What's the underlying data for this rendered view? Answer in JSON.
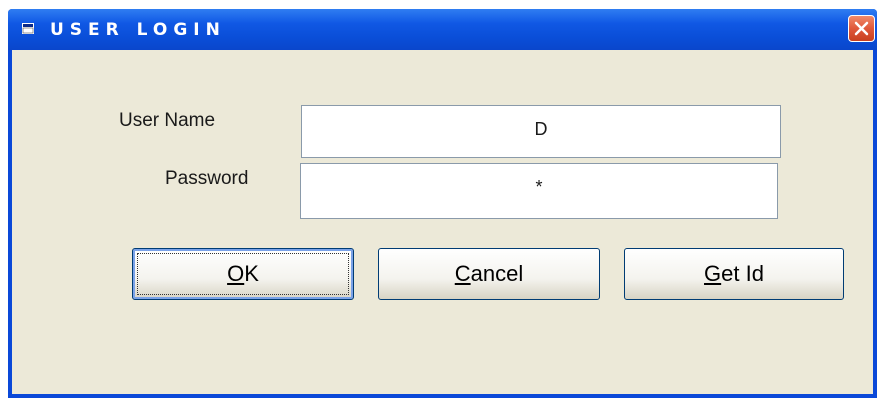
{
  "window": {
    "title": "USER LOGIN",
    "icon": "window-system-icon",
    "close_icon": "close-icon",
    "accent_color": "#0a4ed8",
    "close_color": "#e0583a",
    "client_color": "#ece9d8"
  },
  "form": {
    "username_label": "User Name",
    "username_value": "D",
    "password_label": "Password",
    "password_value": "*"
  },
  "buttons": {
    "ok": {
      "access_key": "O",
      "rest": "K"
    },
    "cancel": {
      "access_key": "C",
      "rest": "ancel"
    },
    "get_id": {
      "access_key": "G",
      "rest": "et Id"
    }
  }
}
